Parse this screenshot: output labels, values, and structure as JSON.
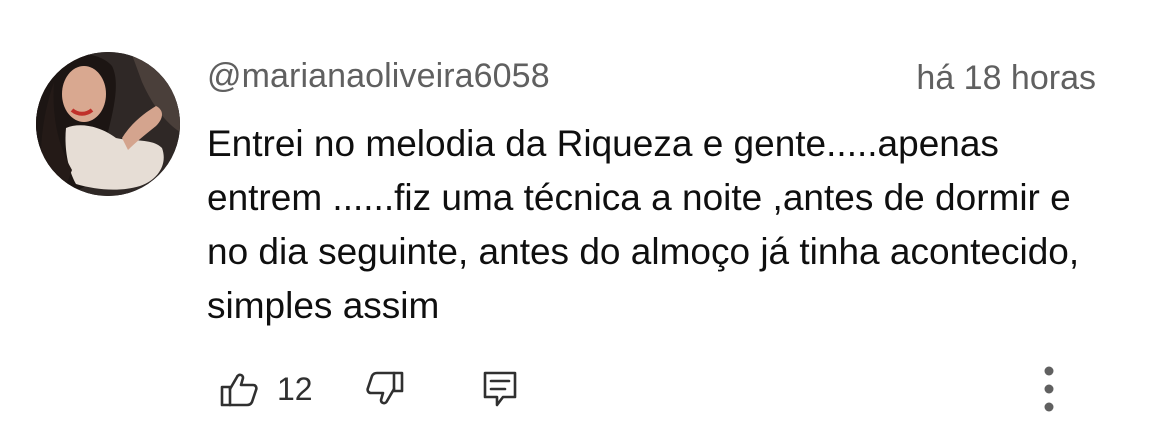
{
  "comment": {
    "author": "@marianaoliveira6058",
    "time": "há 18 horas",
    "text": "Entrei no melodia da Riqueza e gente.....apenas entrem ......fiz uma técnica a noite ,antes de dormir e no dia seguinte, antes do almoço já tinha acontecido, simples assim",
    "likes": "12"
  },
  "icons": {
    "like": "thumb-up-icon",
    "dislike": "thumb-down-icon",
    "reply": "comment-reply-icon",
    "more": "more-vertical-icon"
  },
  "colors": {
    "meta_text": "#606060",
    "body_text": "#0f0f0f",
    "icon": "#303030"
  }
}
